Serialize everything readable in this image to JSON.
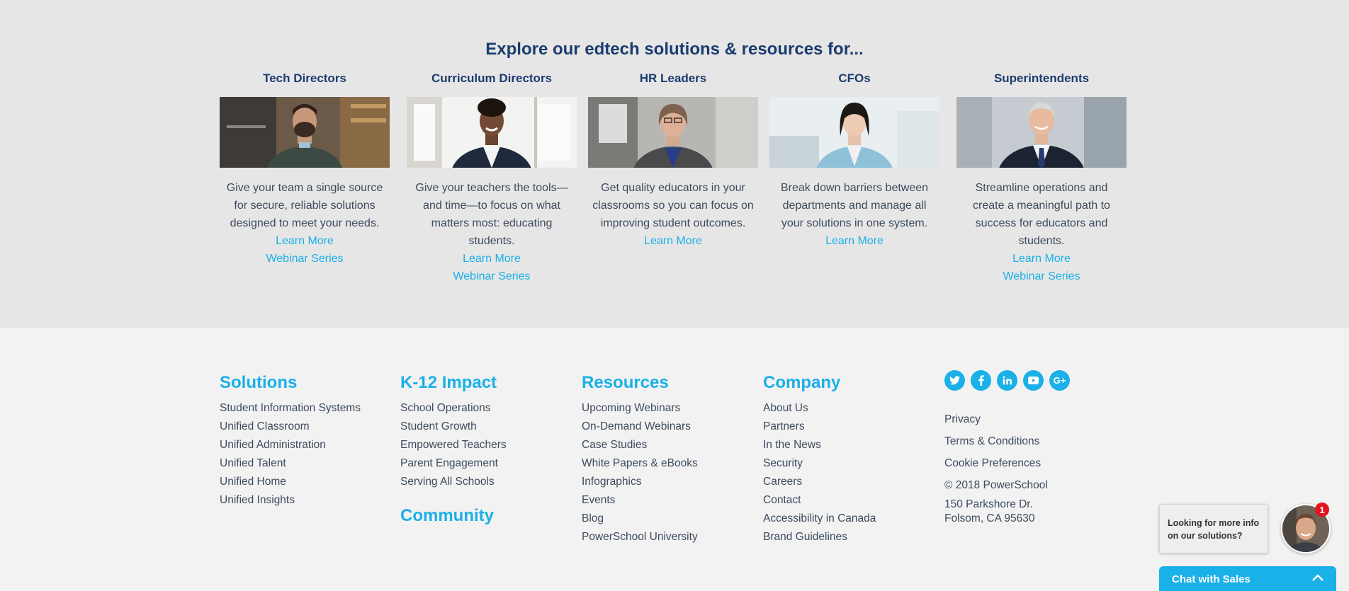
{
  "explore": {
    "title": "Explore our edtech solutions & resources for...",
    "personas": [
      {
        "title": "Tech Directors",
        "desc": "Give your team a single source for secure, reliable solutions designed to meet your needs.",
        "links": [
          "Learn More",
          "Webinar Series"
        ]
      },
      {
        "title": "Curriculum Directors",
        "desc": "Give your teachers the tools—and time—to focus on what matters most: educating students.",
        "links": [
          "Learn More",
          "Webinar Series"
        ]
      },
      {
        "title": "HR Leaders",
        "desc": "Get quality educators in your classrooms so you can focus on improving student outcomes.",
        "links": [
          "Learn More"
        ]
      },
      {
        "title": "CFOs",
        "desc": "Break down barriers between departments and manage all your solutions in one system.",
        "links": [
          "Learn More"
        ]
      },
      {
        "title": "Superintendents",
        "desc": "Streamline operations and create a meaningful path to success for educators and students.",
        "links": [
          "Learn More",
          "Webinar Series"
        ]
      }
    ]
  },
  "footer": {
    "solutions": {
      "title": "Solutions",
      "items": [
        "Student Information Systems",
        "Unified Classroom",
        "Unified Administration",
        "Unified Talent",
        "Unified Home",
        "Unified Insights"
      ]
    },
    "impact": {
      "title": "K-12 Impact",
      "items": [
        "School Operations",
        "Student Growth",
        "Empowered Teachers",
        "Parent Engagement",
        "Serving All Schools"
      ]
    },
    "community": {
      "title": "Community"
    },
    "resources": {
      "title": "Resources",
      "items": [
        "Upcoming Webinars",
        "On-Demand Webinars",
        "Case Studies",
        "White Papers & eBooks",
        "Infographics",
        "Events",
        "Blog",
        "PowerSchool University"
      ]
    },
    "company": {
      "title": "Company",
      "items": [
        "About Us",
        "Partners",
        "In the News",
        "Security",
        "Careers",
        "Contact",
        "Accessibility in Canada",
        "Brand Guidelines"
      ]
    },
    "social_icons": [
      "twitter-icon",
      "facebook-icon",
      "linkedin-icon",
      "youtube-icon",
      "google-plus-icon"
    ],
    "legal": [
      "Privacy",
      "Terms & Conditions",
      "Cookie Preferences",
      "© 2018 PowerSchool"
    ],
    "address": {
      "line1": "150 Parkshore Dr.",
      "line2": "Folsom, CA 95630"
    }
  },
  "chat": {
    "prompt_line1": "Looking for more info",
    "prompt_line2": "on our solutions?",
    "badge_count": "1",
    "bar_label": "Chat with Sales"
  },
  "colors": {
    "accent": "#1ab0e8",
    "heading": "#1b3c6e",
    "body_text": "#3d4b5c",
    "explore_bg": "#e6e6e6",
    "footer_bg": "#f2f2f2",
    "badge": "#e4141f"
  }
}
